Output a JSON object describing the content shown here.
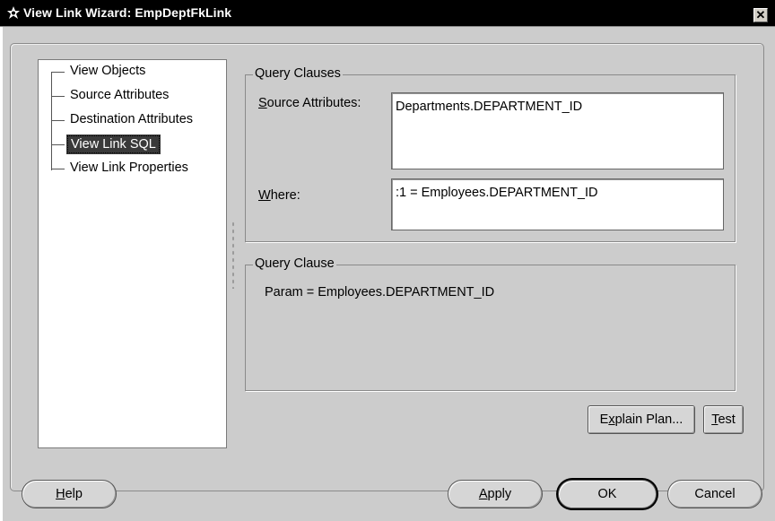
{
  "window": {
    "title": "View Link Wizard: EmpDeptFkLink",
    "close_glyph": "✕",
    "icon": "wizard-icon"
  },
  "nav": {
    "items": [
      {
        "label": "View Objects",
        "selected": false
      },
      {
        "label": "Source Attributes",
        "selected": false
      },
      {
        "label": "Destination Attributes",
        "selected": false
      },
      {
        "label": "View Link SQL",
        "selected": true
      },
      {
        "label": "View Link Properties",
        "selected": false
      }
    ]
  },
  "query_clauses": {
    "legend": "Query Clauses",
    "source_label": {
      "mnemonic": "S",
      "rest": "ource Attributes:"
    },
    "source_value": "Departments.DEPARTMENT_ID",
    "where_label": {
      "mnemonic": "W",
      "rest": "here:"
    },
    "where_value": ":1 = Employees.DEPARTMENT_ID"
  },
  "query_clause": {
    "legend": "Query Clause",
    "text": "Param = Employees.DEPARTMENT_ID"
  },
  "buttons": {
    "explain_plan": {
      "pre": "E",
      "mnemonic": "x",
      "post": "plain Plan..."
    },
    "test": {
      "mnemonic": "T",
      "post": "est"
    },
    "help": {
      "mnemonic": "H",
      "post": "elp"
    },
    "apply": {
      "mnemonic": "A",
      "post": "pply"
    },
    "ok": "OK",
    "cancel": "Cancel"
  },
  "colors": {
    "titlebar": "#000000",
    "dialog_bg": "#cccccc",
    "selection": "#3a3a3a"
  }
}
